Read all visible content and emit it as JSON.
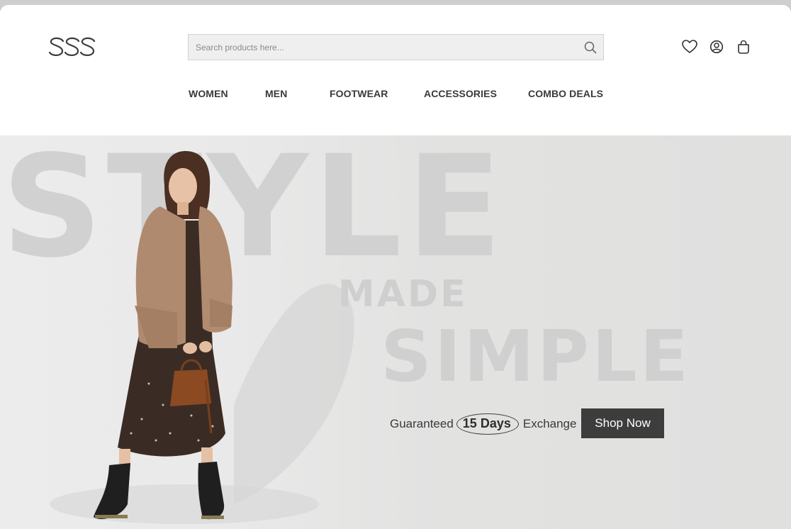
{
  "brand": {
    "logo_text": "SSS"
  },
  "search": {
    "placeholder": "Search products here..."
  },
  "header_icons": [
    {
      "name": "wishlist",
      "icon": "heart-icon"
    },
    {
      "name": "account",
      "icon": "user-circle-icon"
    },
    {
      "name": "cart",
      "icon": "shopping-bag-icon"
    }
  ],
  "nav": {
    "items": [
      {
        "label": "WOMEN"
      },
      {
        "label": "MEN"
      },
      {
        "label": "FOOTWEAR"
      },
      {
        "label": "ACCESSORIES"
      },
      {
        "label": "COMBO DEALS"
      }
    ]
  },
  "hero": {
    "word1": "STYLE",
    "word2": "MADE",
    "word3": "SIMPLE",
    "promo_before": "Guaranteed",
    "promo_days": "15 Days",
    "promo_after": "Exchange",
    "cta_label": "Shop Now"
  },
  "colors": {
    "header_bg": "#ffffff",
    "hero_bg": "#e4e4e3",
    "cta_bg": "#3d3d3d",
    "cta_text": "#ffffff",
    "watermark_text": "#d1d1d1"
  }
}
